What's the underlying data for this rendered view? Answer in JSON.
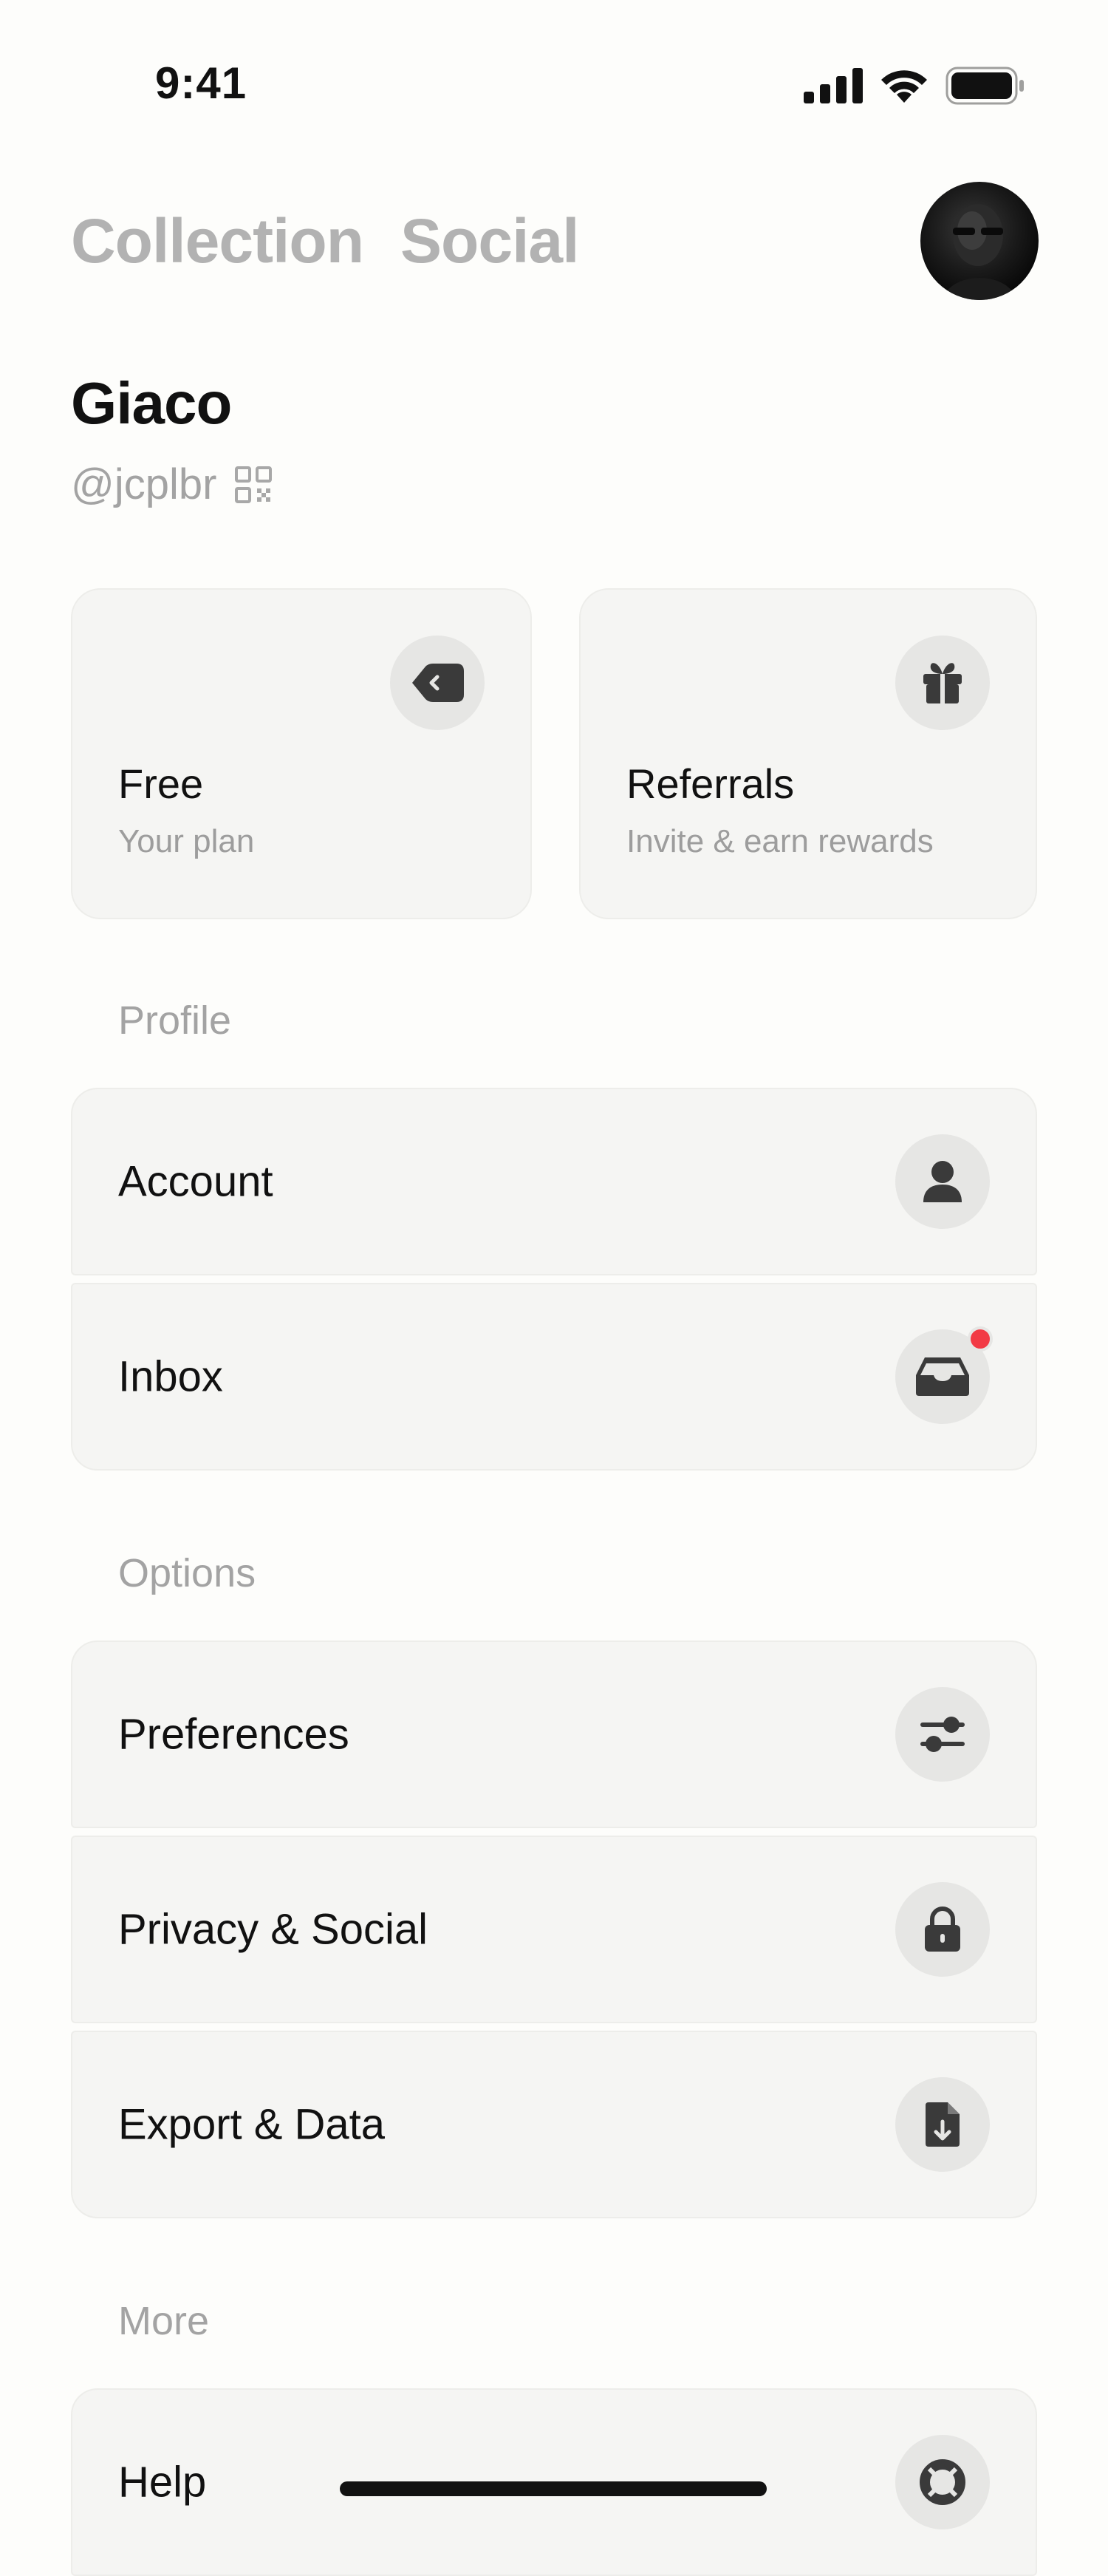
{
  "status_bar": {
    "time": "9:41"
  },
  "tabs": [
    {
      "label": "Collection"
    },
    {
      "label": "Social"
    }
  ],
  "user": {
    "name": "Giaco",
    "handle": "@jcplbr"
  },
  "cards": [
    {
      "title": "Free",
      "subtitle": "Your plan",
      "icon": "tag-icon"
    },
    {
      "title": "Referrals",
      "subtitle": "Invite & earn rewards",
      "icon": "gift-icon"
    }
  ],
  "sections": {
    "profile": {
      "title": "Profile",
      "items": [
        {
          "label": "Account",
          "icon": "person-icon"
        },
        {
          "label": "Inbox",
          "icon": "inbox-icon"
        }
      ]
    },
    "options": {
      "title": "Options",
      "items": [
        {
          "label": "Preferences",
          "icon": "sliders-icon"
        },
        {
          "label": "Privacy & Social",
          "icon": "lock-icon"
        },
        {
          "label": "Export & Data",
          "icon": "file-download-icon"
        }
      ]
    },
    "more": {
      "title": "More",
      "items": [
        {
          "label": "Help",
          "icon": "lifebuoy-icon"
        }
      ]
    }
  },
  "colors": {
    "background": "#FDFDFB",
    "card": "#F5F5F3",
    "icon_circle": "#E6E6E4",
    "muted_text": "#A3A3A3",
    "notification": "#F23A45"
  }
}
